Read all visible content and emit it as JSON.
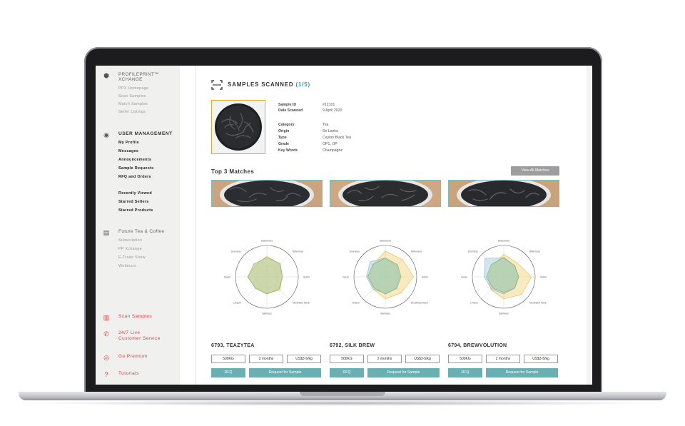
{
  "sidebar": {
    "brand": {
      "title_line1": "PROFILEPRINT™",
      "title_line2": "XCHANGE",
      "items": [
        "PPX Homepage",
        "Scan Samples",
        "Match Samples",
        "Seller Listings"
      ]
    },
    "user_management": {
      "title": "USER MANAGEMENT",
      "items": [
        "My Profile",
        "Messages",
        "Announcements",
        "Sample Requests",
        "RFQ and Orders"
      ],
      "items2": [
        "Recently Viewed",
        "Starred Sellers",
        "Starred Products"
      ]
    },
    "future": {
      "title": "Future Tea & Coffee",
      "items": [
        "Subscription",
        "PP Xchange",
        "E-Trade Show",
        "Webinars"
      ]
    },
    "bottom": [
      {
        "icon": "scan-icon",
        "label": "Scan Samples"
      },
      {
        "icon": "phone-icon",
        "label1": "24/7 Live",
        "label2": "Customer Service"
      },
      {
        "icon": "premium-icon",
        "label": "Go Premium"
      },
      {
        "icon": "help-icon",
        "label": "Tutorials"
      }
    ]
  },
  "main": {
    "title": "SAMPLES SCANNED",
    "count": "(1/5)",
    "sample": {
      "fields": [
        {
          "label": "Sample ID",
          "value": "#12101"
        },
        {
          "label": "Date Scanned",
          "value": "9 April 2020"
        },
        {
          "label": "Category",
          "value": "Tea"
        },
        {
          "label": "Origin",
          "value": "Sri Lanka"
        },
        {
          "label": "Type",
          "value": "Ceylon Black Tea"
        },
        {
          "label": "Grade",
          "value": "OP1, OP"
        },
        {
          "label": "Key Words",
          "value": "Champagne"
        }
      ]
    },
    "matches_title": "Top 3 Matches",
    "view_all": "View All Matches",
    "radar_axes": [
      "Sweetness",
      "Bitterness",
      "Astringency",
      "Mouthfeel Astringency",
      "Saltiness",
      "Umami",
      "Richness",
      "Sourness"
    ],
    "matches": [
      {
        "name": "6793, TEAZYTEA",
        "qty": "500KG",
        "lead": "2 months",
        "price": "US$3-5/kg",
        "rfq": "RFQ",
        "request": "Request for Sample"
      },
      {
        "name": "6792, SILK BREW",
        "qty": "500KG",
        "lead": "2 months",
        "price": "US$3-5/kg",
        "rfq": "RFQ",
        "request": "Request for Sample"
      },
      {
        "name": "6794, BREWVOLUTION",
        "qty": "500KG",
        "lead": "2 months",
        "price": "US$3-5/kg",
        "rfq": "RFQ",
        "request": "Request for Sample"
      }
    ],
    "colors": {
      "accent_blue": "#3a8fc8",
      "teal": "#6aafb4",
      "orange": "#e7a73a",
      "red": "#e03a3a"
    }
  }
}
